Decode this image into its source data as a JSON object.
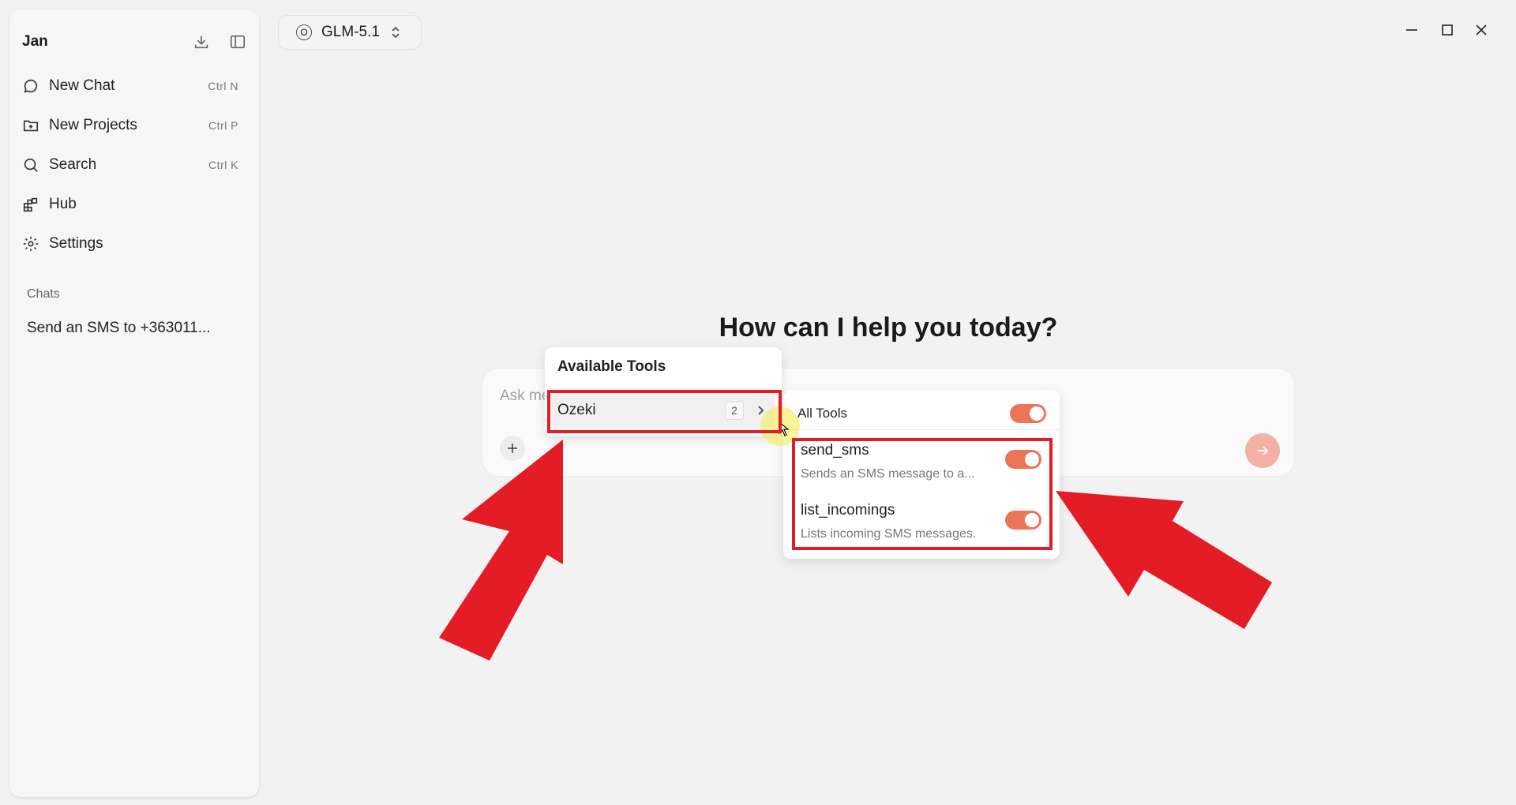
{
  "sidebar": {
    "app_name": "Jan",
    "items": [
      {
        "label": "New Chat",
        "shortcut": "Ctrl  N"
      },
      {
        "label": "New Projects",
        "shortcut": "Ctrl  P"
      },
      {
        "label": "Search",
        "shortcut": "Ctrl  K"
      },
      {
        "label": "Hub",
        "shortcut": ""
      },
      {
        "label": "Settings",
        "shortcut": ""
      }
    ],
    "chats_label": "Chats",
    "chats": [
      "Send an SMS to +363011..."
    ]
  },
  "model_selector": {
    "mark": "O",
    "label": "GLM-5.1"
  },
  "main": {
    "headline": "How can I help you today?",
    "input_placeholder": "Ask me"
  },
  "tools_popover": {
    "title": "Available Tools",
    "provider": {
      "name": "Ozeki",
      "count": "2"
    }
  },
  "tools_submenu": {
    "all_tools_label": "All Tools",
    "all_tools_enabled": true,
    "tools": [
      {
        "name": "send_sms",
        "description": "Sends an SMS message to a...",
        "enabled": true
      },
      {
        "name": "list_incomings",
        "description": "Lists incoming SMS messages.",
        "enabled": true
      }
    ]
  },
  "colors": {
    "accent": "#ee7457",
    "highlight": "#e31c25",
    "send_button": "#f3b1a3"
  }
}
